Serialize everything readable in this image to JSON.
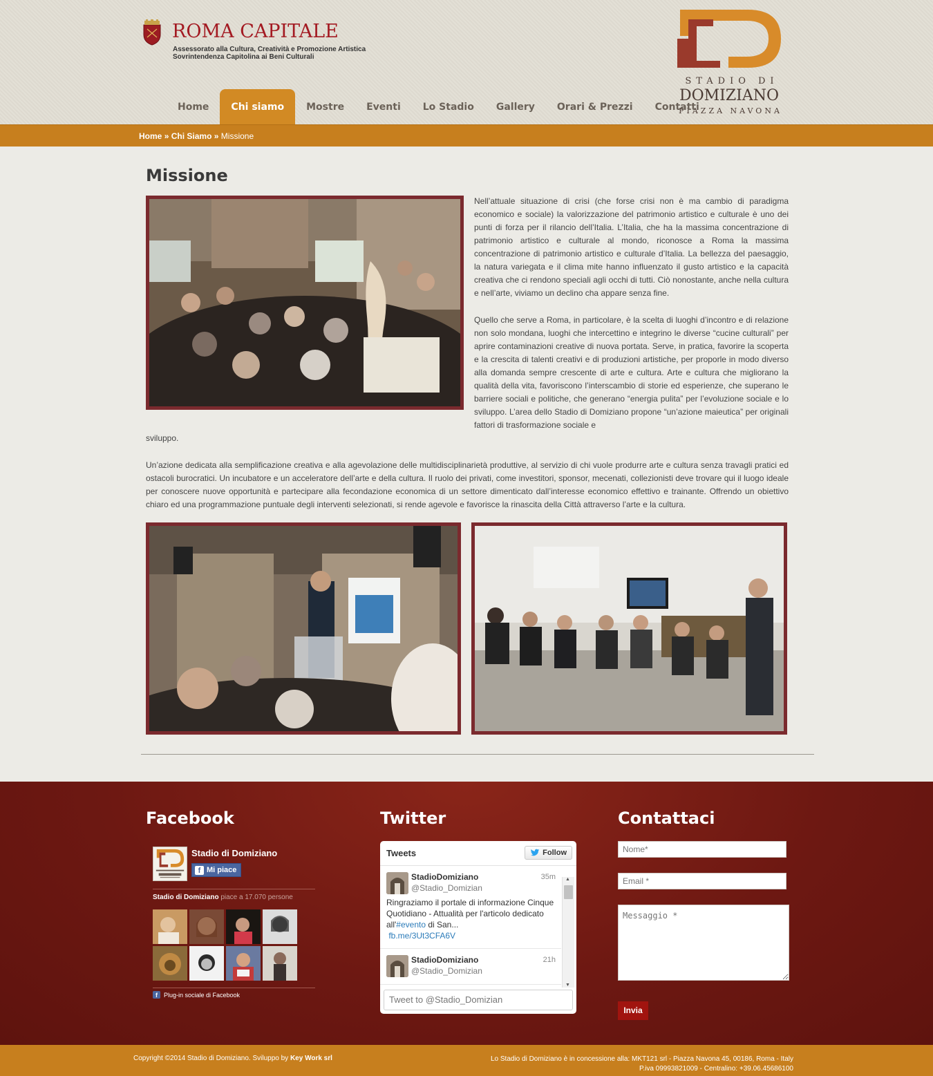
{
  "header": {
    "roma_title": "ROMA CAPITALE",
    "roma_sub_1": "Assessorato alla Cultura, Creatività e Promozione Artistica",
    "roma_sub_2": "Sovrintendenza Capitolina ai Beni Culturali",
    "stadio_line_1": "STADIO DI",
    "stadio_line_2": "DOMIZIANO",
    "stadio_line_3": "PIAZZA NAVONA"
  },
  "nav": {
    "items": [
      {
        "label": "Home"
      },
      {
        "label": "Chi siamo"
      },
      {
        "label": "Mostre"
      },
      {
        "label": "Eventi"
      },
      {
        "label": "Lo Stadio"
      },
      {
        "label": "Gallery"
      },
      {
        "label": "Orari & Prezzi"
      },
      {
        "label": "Contatti"
      }
    ],
    "active_index": 1
  },
  "breadcrumb": {
    "home": "Home",
    "sep": "»",
    "section": "Chi Siamo",
    "current": "Missione"
  },
  "main": {
    "title": "Missione",
    "p1": "Nell’attuale situazione di crisi (che forse crisi non è ma cambio di paradigma economico e sociale) la valorizzazione del patrimonio artistico e culturale è uno dei punti di forza per il rilancio dell’Italia. L’Italia, che ha la massima concentrazione di patrimonio artistico e culturale al mondo, riconosce a Roma la massima concentrazione di patrimonio artistico e culturale d’Italia. La bellezza del paesaggio, la natura variegata e il clima mite hanno influenzato il gusto artistico e la capacità creativa che ci rendono speciali agli occhi di tutti. Ciò nonostante, anche nella cultura e nell’arte, viviamo un declino cha appare senza fine.",
    "p2": "Quello che serve a Roma, in particolare, è la scelta di luoghi d’incontro e di relazione non solo mondana, luoghi che intercettino e integrino le diverse “cucine culturali” per aprire contaminazioni creative di nuova portata. Serve, in pratica, favorire la scoperta e la crescita di talenti creativi e di produzioni artistiche, per proporle in modo diverso alla domanda sempre crescente di arte e cultura. Arte e cultura che migliorano la qualità della vita, favoriscono l’interscambio di storie ed esperienze, che superano le barriere sociali e politiche, che generano “energia pulita” per l’evoluzione sociale e lo sviluppo. L’area dello Stadio di Domiziano propone “un’azione maieutica” per originali fattori di trasformazione sociale e",
    "p2_tail": "sviluppo.",
    "p3": "Un’azione dedicata alla semplificazione creativa e alla agevolazione delle multidisciplinarietà produttive, al servizio di chi vuole produrre arte e cultura senza travagli pratici ed ostacoli burocratici. Un incubatore e un acceleratore dell’arte e della cultura. Il ruolo dei privati, come investitori, sponsor, mecenati, collezionisti deve trovare qui il luogo ideale per conoscere nuove opportunità e partecipare alla fecondazione economica di un settore dimenticato dall’interesse economico effettivo e trainante. Offrendo un obiettivo chiaro ed una programmazione puntuale degli interventi selezionati, si rende agevole e favorisce la rinascita della Città attraverso l’arte e la cultura."
  },
  "footer": {
    "facebook": {
      "title": "Facebook",
      "page_name": "Stadio di Domiziano",
      "like_label": "Mi piace",
      "count_name": "Stadio di Domiziano",
      "count_text": " piace a 17.070 persone",
      "plugin_label": "Plug-in sociale di Facebook",
      "f_glyph": "f"
    },
    "twitter": {
      "title": "Twitter",
      "header": "Tweets",
      "follow_label": "Follow",
      "tweets": [
        {
          "user": "StadioDomiziano",
          "handle": "@Stadio_Domizian",
          "time": "35m",
          "text_before": "Ringraziamo il portale di informazione Cinque Quotidiano - Attualità per l'articolo dedicato all'",
          "hashtag": "#evento",
          "text_after": " di San...",
          "link": "fb.me/3Ut3CFA6V"
        },
        {
          "user": "StadioDomiziano",
          "handle": "@Stadio_Domizian",
          "time": "21h"
        }
      ],
      "input_placeholder": "Tweet to @Stadio_Domizian"
    },
    "contact": {
      "title": "Contattaci",
      "name_placeholder": "Nome*",
      "email_placeholder": "Email *",
      "message_placeholder": "Messaggio *",
      "submit_label": "Invia"
    },
    "copyright": "Copyright ©2014 Stadio di Domiziano. Sviluppo by ",
    "developer": "Key Work srl",
    "address_1": "Lo Stadio di Domiziano è in concessione alla: MKT121 srl - Piazza Navona 45, 00186, Roma - Italy",
    "address_2": "P.iva 09993821009 - Centralino: +39.06.45686100"
  },
  "colors": {
    "accent_orange": "#c77f1e",
    "nav_active": "#d28a24",
    "roma_red": "#a31a22",
    "photo_border": "#7b2a2e",
    "footer_red": "#6d1812",
    "submit_red": "#a1140f"
  }
}
